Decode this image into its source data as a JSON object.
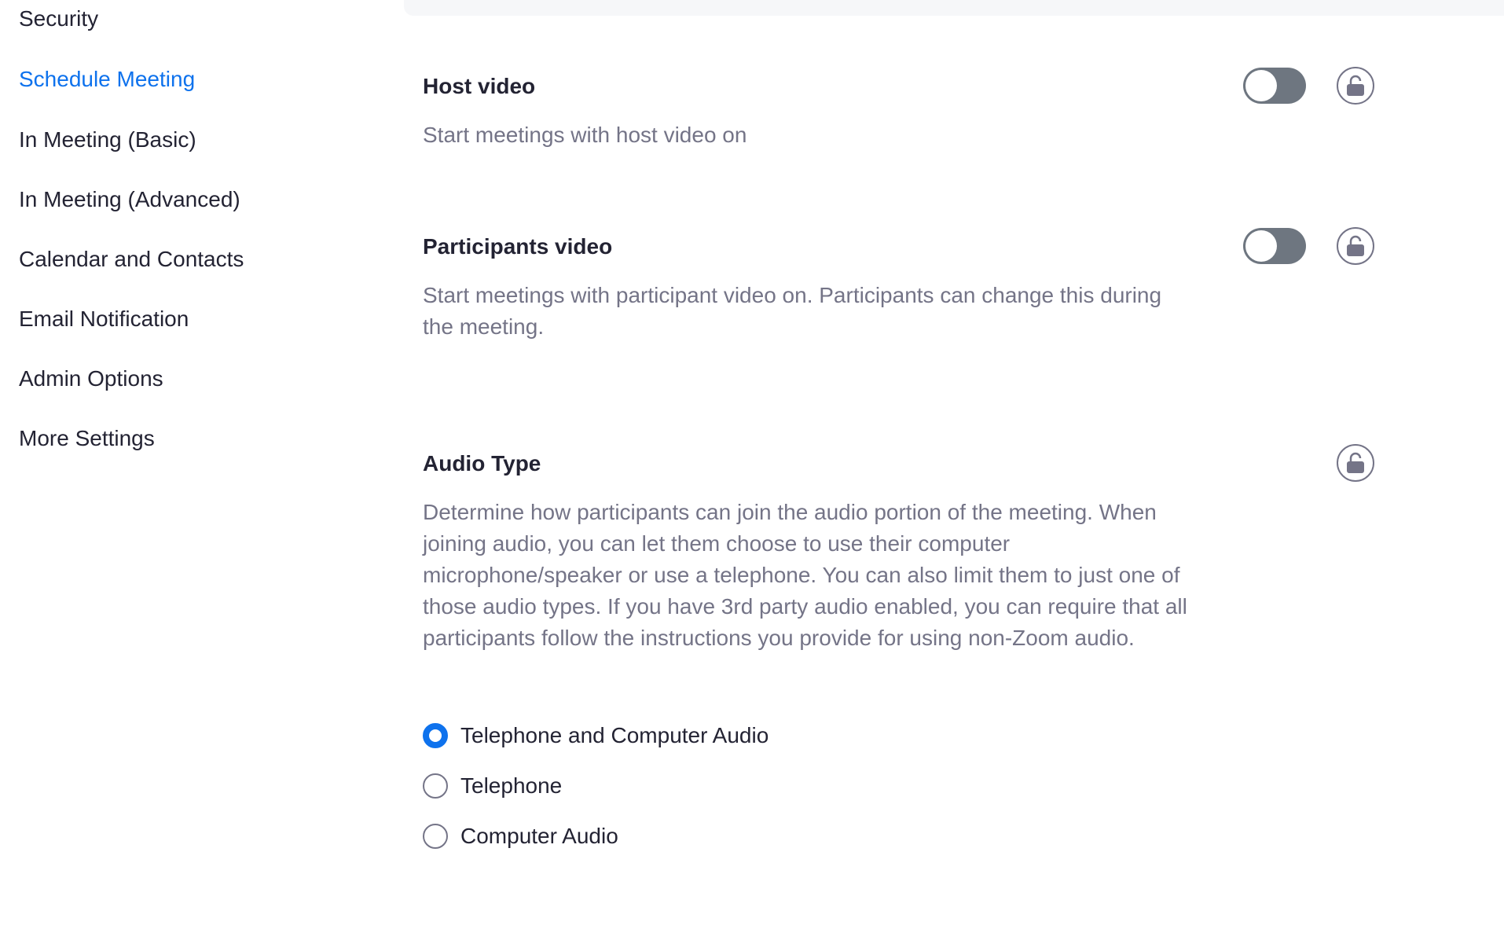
{
  "sidebar": {
    "items": [
      {
        "label": "Security",
        "active": false
      },
      {
        "label": "Schedule Meeting",
        "active": true
      },
      {
        "label": "In Meeting (Basic)",
        "active": false
      },
      {
        "label": "In Meeting (Advanced)",
        "active": false
      },
      {
        "label": "Calendar and Contacts",
        "active": false
      },
      {
        "label": "Email Notification",
        "active": false
      },
      {
        "label": "Admin Options",
        "active": false
      },
      {
        "label": "More Settings",
        "active": false
      }
    ]
  },
  "settings": {
    "host_video": {
      "title": "Host video",
      "description": "Start meetings with host video on",
      "toggle_on": false
    },
    "participants_video": {
      "title": "Participants video",
      "description": "Start meetings with participant video on. Participants can change this during the meeting.",
      "toggle_on": false
    },
    "audio_type": {
      "title": "Audio Type",
      "description": "Determine how participants can join the audio portion of the meeting. When joining audio, you can let them choose to use their computer microphone/speaker or use a telephone. You can also limit them to just one of those audio types. If you have 3rd party audio enabled, you can require that all participants follow the instructions you provide for using non-Zoom audio.",
      "options": [
        {
          "label": "Telephone and Computer Audio",
          "selected": true
        },
        {
          "label": "Telephone",
          "selected": false
        },
        {
          "label": "Computer Audio",
          "selected": false
        }
      ]
    }
  },
  "colors": {
    "accent": "#0e72ed",
    "text": "#232333",
    "muted": "#747487",
    "toggle_off": "#6e7680"
  },
  "icons": {
    "lock": "unlocked-lock-icon"
  }
}
